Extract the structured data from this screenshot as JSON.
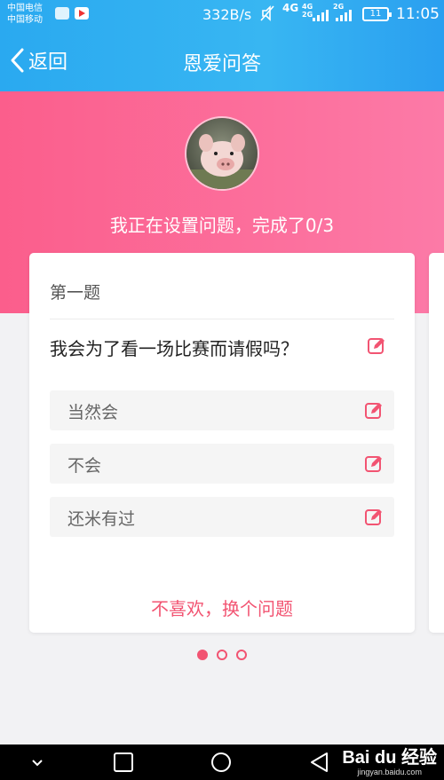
{
  "status_bar": {
    "carrier_1": "中国电信",
    "carrier_2": "中国移动",
    "net_speed": "332B/s",
    "network_type": "4G",
    "network_sub_1": "4G",
    "network_sub_2": "2G",
    "network_sub_3": "2G",
    "battery": "11",
    "time": "11:05"
  },
  "nav": {
    "back_label": "返回",
    "title": "恩爱问答"
  },
  "hero": {
    "progress_text": "我正在设置问题，完成了0/3"
  },
  "card": {
    "question_index": "第一题",
    "question_text": "我会为了看一场比赛而请假吗？",
    "options": [
      {
        "label": "当然会"
      },
      {
        "label": "不会"
      },
      {
        "label": "还米有过"
      }
    ],
    "switch_label": "不喜欢，换个问题"
  },
  "pager": {
    "total": 3,
    "active": 1
  },
  "watermark": {
    "brand": "Bai du 经验",
    "url": "jingyan.baidu.com"
  },
  "colors": {
    "accent": "#f25472",
    "header_blue": "#2aa9f0",
    "hero_pink": "#fb5e8c"
  }
}
